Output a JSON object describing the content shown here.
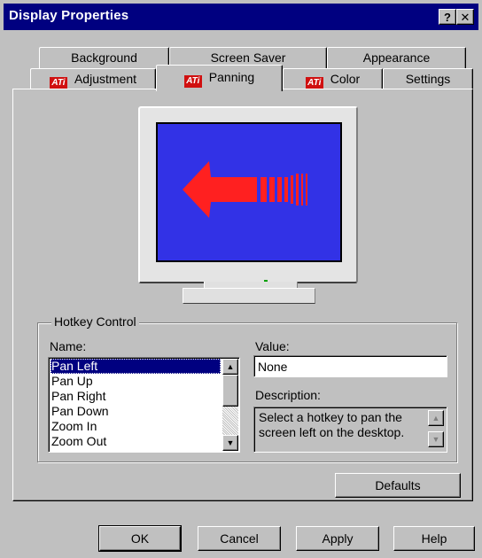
{
  "window": {
    "title": "Display Properties",
    "help_button": "?",
    "close_button": "✕"
  },
  "tabs": {
    "row_back": [
      {
        "label": "Background"
      },
      {
        "label": "Screen Saver"
      },
      {
        "label": "Appearance"
      }
    ],
    "row_front": [
      {
        "label": "Adjustment",
        "ati_icon": true
      },
      {
        "label": "Panning",
        "ati_icon": true,
        "active": true
      },
      {
        "label": "Color",
        "ati_icon": true
      },
      {
        "label": "Settings"
      }
    ],
    "ati_logo_text": "ATi"
  },
  "preview": {
    "screen_color": "#3232e6",
    "arrow_color": "#ff2020",
    "icon": "pan-left-arrow-icon"
  },
  "hotkey": {
    "group_label": "Hotkey Control",
    "name_label": "Name:",
    "value_label": "Value:",
    "description_label": "Description:",
    "names": [
      "Pan Left",
      "Pan Up",
      "Pan Right",
      "Pan Down",
      "Zoom In",
      "Zoom Out"
    ],
    "selected_index": 0,
    "value": "None",
    "description": "Select a hotkey to pan the screen left on the desktop."
  },
  "buttons": {
    "defaults": "Defaults",
    "ok": "OK",
    "cancel": "Cancel",
    "apply": "Apply",
    "help": "Help"
  },
  "colors": {
    "titlebar": "#000080",
    "face": "#c0c0c0",
    "selection": "#000080"
  }
}
